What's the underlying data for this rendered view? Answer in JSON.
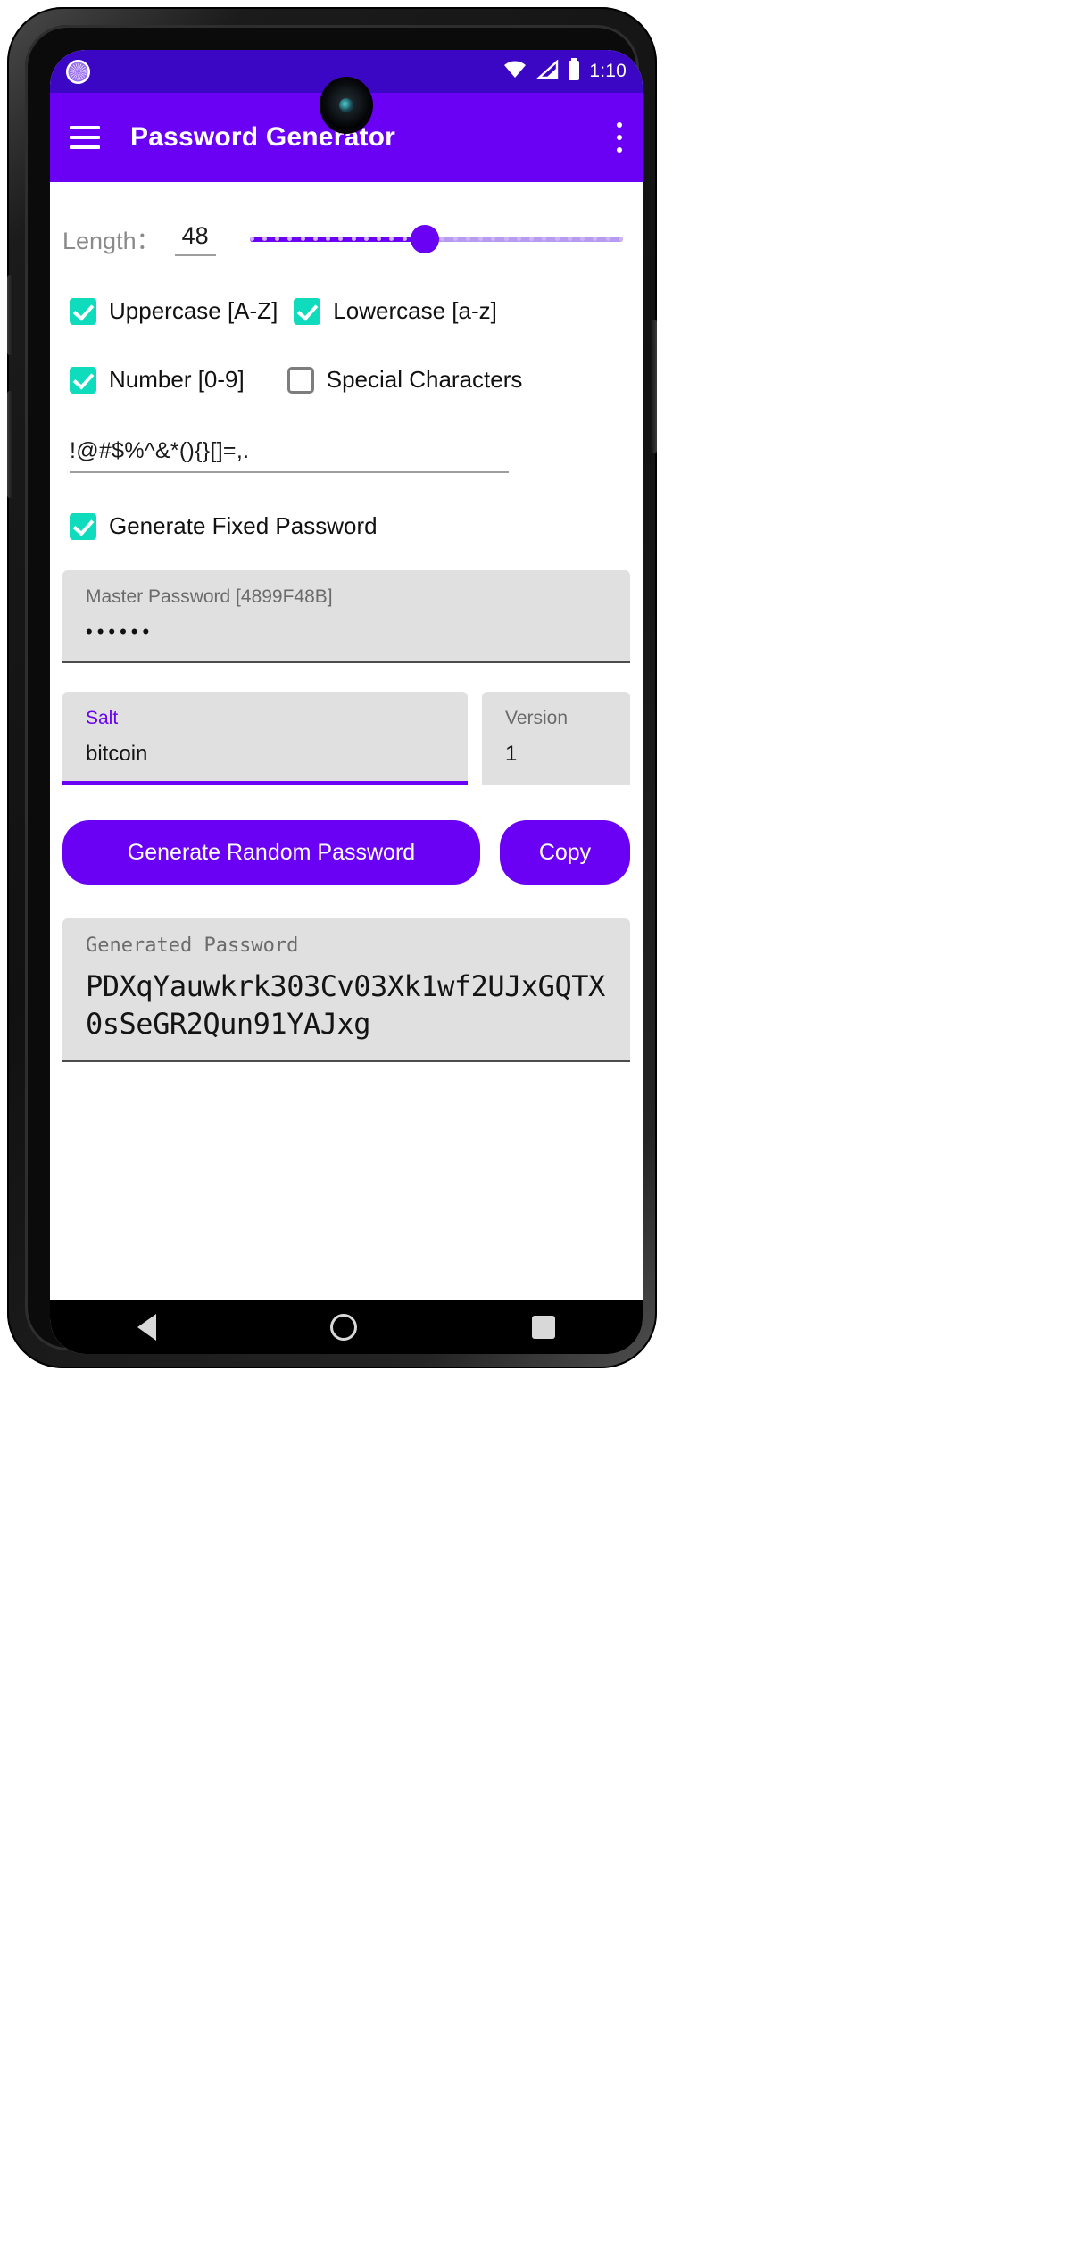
{
  "status_bar": {
    "spinner_icon": "spinner-icon",
    "wifi_icon": "wifi-icon",
    "signal_icon": "cell-signal-icon",
    "battery_icon": "battery-icon",
    "clock": "1:10"
  },
  "app_bar": {
    "menu_icon": "hamburger-menu-icon",
    "title": "Password Generator",
    "overflow_icon": "more-vertical-icon"
  },
  "length": {
    "label": "Length：",
    "value": "48",
    "slider_percent": 47
  },
  "checkboxes": [
    {
      "label": "Uppercase [A-Z]",
      "checked": true
    },
    {
      "label": "Lowercase [a-z]",
      "checked": true
    },
    {
      "label": "Number [0-9]",
      "checked": true
    },
    {
      "label": "Special Characters",
      "checked": false
    }
  ],
  "special_characters": {
    "value": "!@#$%^&*(){}[]=,."
  },
  "fixed_password": {
    "label": "Generate Fixed Password",
    "checked": true
  },
  "master_password": {
    "label": "Master Password [4899F48B]",
    "value": "••••••"
  },
  "salt": {
    "label": "Salt",
    "value": "bitcoin",
    "focused": true
  },
  "version": {
    "label": "Version",
    "value": "1"
  },
  "buttons": {
    "generate": "Generate Random Password",
    "copy": "Copy"
  },
  "generated": {
    "label": "Generated Password",
    "value": "PDXqYauwkrk303Cv03Xk1wf2UJxGQTX0sSeGR2Qun91YAJxg"
  },
  "nav_bar": {
    "back_icon": "back-triangle-icon",
    "home_icon": "home-circle-icon",
    "recents_icon": "recents-square-icon"
  },
  "colors": {
    "primary": "#6a00f4",
    "status_bar": "#3b07c4",
    "checkbox_on": "#0fdbbd",
    "field_bg": "#e0e0e0"
  }
}
